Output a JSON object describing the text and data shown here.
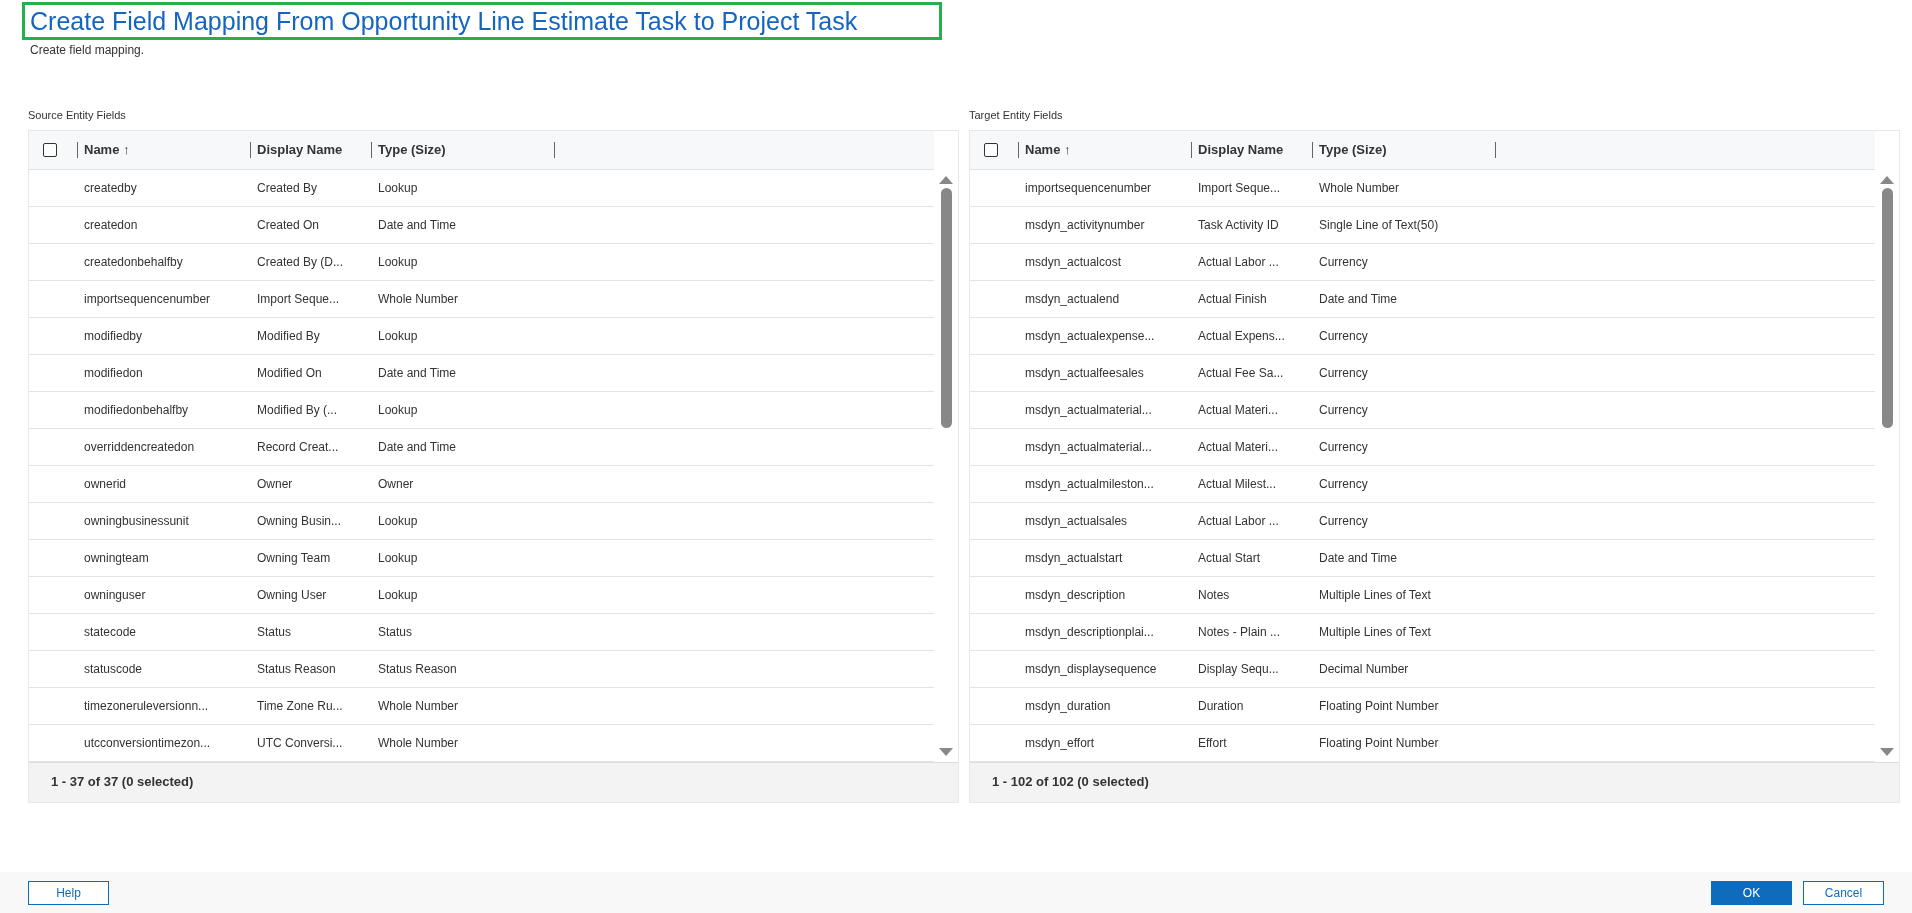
{
  "title": "Create Field Mapping From Opportunity Line Estimate Task to Project Task",
  "subtitle": "Create field mapping.",
  "tables": [
    {
      "label": "Source Entity Fields",
      "select_all_checked": false,
      "columns": [
        "Name ↑",
        "Display Name",
        "Type (Size)"
      ],
      "rows": [
        [
          "createdby",
          "Created By",
          "Lookup"
        ],
        [
          "createdon",
          "Created On",
          "Date and Time"
        ],
        [
          "createdonbehalfby",
          "Created By (D...",
          "Lookup"
        ],
        [
          "importsequencenumber",
          "Import Seque...",
          "Whole Number"
        ],
        [
          "modifiedby",
          "Modified By",
          "Lookup"
        ],
        [
          "modifiedon",
          "Modified On",
          "Date and Time"
        ],
        [
          "modifiedonbehalfby",
          "Modified By (...",
          "Lookup"
        ],
        [
          "overriddencreatedon",
          "Record Creat...",
          "Date and Time"
        ],
        [
          "ownerid",
          "Owner",
          "Owner"
        ],
        [
          "owningbusinessunit",
          "Owning Busin...",
          "Lookup"
        ],
        [
          "owningteam",
          "Owning Team",
          "Lookup"
        ],
        [
          "owninguser",
          "Owning User",
          "Lookup"
        ],
        [
          "statecode",
          "Status",
          "Status"
        ],
        [
          "statuscode",
          "Status Reason",
          "Status Reason"
        ],
        [
          "timezoneruleversionn...",
          "Time Zone Ru...",
          "Whole Number"
        ],
        [
          "utcconversiontimezon...",
          "UTC Conversi...",
          "Whole Number"
        ]
      ],
      "footer": "1 - 37 of 37 (0 selected)"
    },
    {
      "label": "Target Entity Fields",
      "select_all_checked": false,
      "columns": [
        "Name ↑",
        "Display Name",
        "Type (Size)"
      ],
      "rows": [
        [
          "importsequencenumber",
          "Import Seque...",
          "Whole Number"
        ],
        [
          "msdyn_activitynumber",
          "Task Activity ID",
          "Single Line of Text(50)"
        ],
        [
          "msdyn_actualcost",
          "Actual Labor ...",
          "Currency"
        ],
        [
          "msdyn_actualend",
          "Actual Finish",
          "Date and Time"
        ],
        [
          "msdyn_actualexpense...",
          "Actual Expens...",
          "Currency"
        ],
        [
          "msdyn_actualfeesales",
          "Actual Fee Sa...",
          "Currency"
        ],
        [
          "msdyn_actualmaterial...",
          "Actual Materi...",
          "Currency"
        ],
        [
          "msdyn_actualmaterial...",
          "Actual Materi...",
          "Currency"
        ],
        [
          "msdyn_actualmileston...",
          "Actual Milest...",
          "Currency"
        ],
        [
          "msdyn_actualsales",
          "Actual Labor ...",
          "Currency"
        ],
        [
          "msdyn_actualstart",
          "Actual Start",
          "Date and Time"
        ],
        [
          "msdyn_description",
          "Notes",
          "Multiple Lines of Text"
        ],
        [
          "msdyn_descriptionplai...",
          "Notes - Plain ...",
          "Multiple Lines of Text"
        ],
        [
          "msdyn_displaysequence",
          "Display Sequ...",
          "Decimal Number"
        ],
        [
          "msdyn_duration",
          "Duration",
          "Floating Point Number"
        ],
        [
          "msdyn_effort",
          "Effort",
          "Floating Point Number"
        ]
      ],
      "footer": "1 - 102 of 102 (0 selected)"
    }
  ],
  "buttons": {
    "help": "Help",
    "ok": "OK",
    "cancel": "Cancel"
  }
}
